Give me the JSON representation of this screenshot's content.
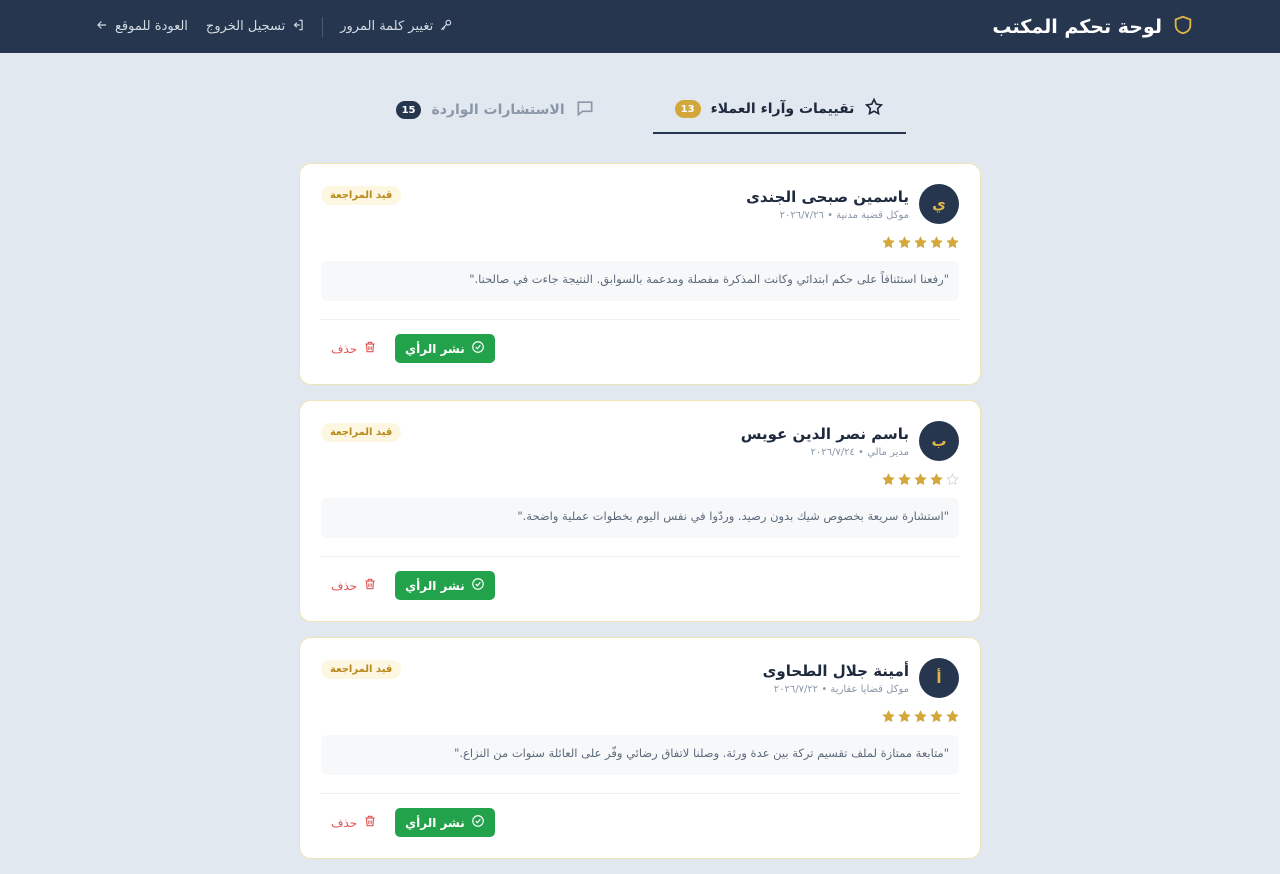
{
  "header": {
    "title": "لوحة تحكم المكتب",
    "change_password": "تغيير كلمة المرور",
    "logout": "تسجيل الخروج",
    "back_to_site": "العودة للموقع"
  },
  "tabs": [
    {
      "label": "تقييمات وآراء العملاء",
      "count": "13"
    },
    {
      "label": "الاستشارات الواردة",
      "count": "15"
    }
  ],
  "reviews": [
    {
      "initial": "ي",
      "name": "ياسمين صبحى الجندى",
      "meta": "موكل قضية مدنية • ٢٠٢٦/٧/٢٦",
      "status": "قيد المراجعة",
      "rating": 5,
      "text": "\"رفعنا استئنافاً على حكم ابتدائي وكانت المذكرة مفصلة ومدعمة بالسوابق. النتيجة جاءت في صالحنا.\"",
      "publish_label": "نشر الرأي",
      "delete_label": "حذف"
    },
    {
      "initial": "ب",
      "name": "باسم نصر الدين عويس",
      "meta": "مدير مالي • ٢٠٢٦/٧/٢٤",
      "status": "قيد المراجعة",
      "rating": 4,
      "text": "\"استشارة سريعة بخصوص شيك بدون رصيد. وردّوا في نفس اليوم بخطوات عملية واضحة.\"",
      "publish_label": "نشر الرأي",
      "delete_label": "حذف"
    },
    {
      "initial": "أ",
      "name": "أمينة جلال الطحاوى",
      "meta": "موكل قضايا عقارية • ٢٠٢٦/٧/٢٢",
      "status": "قيد المراجعة",
      "rating": 5,
      "text": "\"متابعة ممتازة لملف تقسيم تركة بين عدة ورثة. وصلنا لاتفاق رضائي وفّر على العائلة سنوات من النزاع.\"",
      "publish_label": "نشر الرأي",
      "delete_label": "حذف"
    }
  ],
  "colors": {
    "navy": "#26364f",
    "gold": "#d3a83a",
    "green": "#22a24a",
    "red": "#e05555"
  }
}
